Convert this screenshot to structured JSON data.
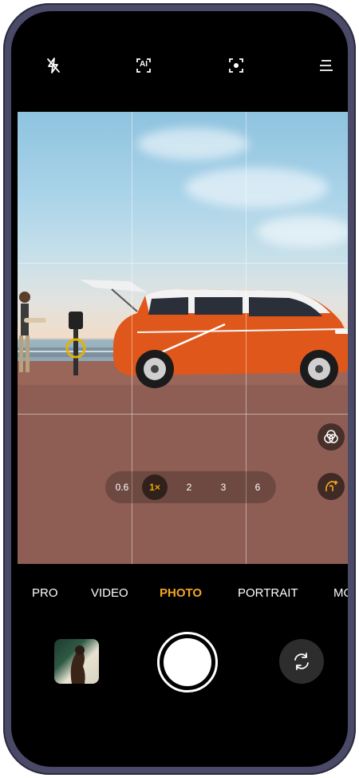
{
  "top_bar": {
    "icons": [
      "flash-off-icon",
      "ai-scene-icon",
      "focus-icon",
      "menu-icon"
    ],
    "ai_label": "AI"
  },
  "viewfinder": {
    "zoom": {
      "options": [
        "0.6",
        "1×",
        "2",
        "3",
        "6"
      ],
      "selected": "1×"
    },
    "side_buttons": [
      "filters-icon",
      "beauty-icon"
    ],
    "accent_color": "#f5a623"
  },
  "modes": {
    "items": [
      "PRO",
      "VIDEO",
      "PHOTO",
      "PORTRAIT",
      "MO"
    ],
    "active": "PHOTO"
  },
  "bottom": {
    "gallery_thumbnail": "gallery-thumbnail",
    "shutter": "shutter-button",
    "switch_camera": "switch-camera-icon"
  }
}
